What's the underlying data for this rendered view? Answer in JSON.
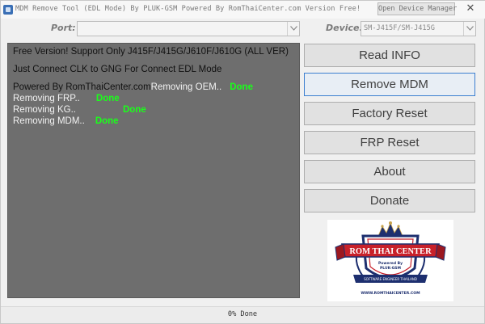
{
  "window": {
    "title": "MDM Remove Tool (EDL Mode) By PLUK-GSM Powered By RomThaiCenter.com Version Free!",
    "open_device_manager_label": "Open Device Manager",
    "close_glyph": "✕"
  },
  "port": {
    "label": "Port:",
    "value": ""
  },
  "device": {
    "label": "Device:",
    "value": "SM-J415F/SM-J415G"
  },
  "log": {
    "line1": "Free Version! Support Only J415F/J415G/J610F/J610G (ALL VER)",
    "line2": "Just Connect CLK to GNG For Connect EDL Mode",
    "powered": "Powered By RomThaiCenter.com",
    "oem_label": "Removing OEM..",
    "oem_status": "Done",
    "frp_label": "Removing FRP..",
    "frp_status": "Done",
    "kg_label": "Removing KG..",
    "kg_status": "Done",
    "mdm_label": "Removing MDM..",
    "mdm_status": "Done"
  },
  "actions": {
    "read_info": "Read INFO",
    "remove_mdm": "Remove MDM",
    "factory_reset": "Factory Reset",
    "frp_reset": "FRP Reset",
    "about": "About",
    "donate": "Donate"
  },
  "logo": {
    "title": "ROM THAI CENTER",
    "powered_line1": "Powered By",
    "powered_line2": "PLUK-GSM",
    "tagline": "SOFTWARE ENGINEER THAILAND",
    "url": "WWW.ROMTHAICENTER.COM"
  },
  "status": {
    "progress_percent": 0,
    "text": "0% Done"
  },
  "colors": {
    "log_background": "#6e6e6e",
    "done_green": "#1aff1a",
    "logo_navy": "#1d2f6f",
    "logo_red": "#c8212a"
  }
}
